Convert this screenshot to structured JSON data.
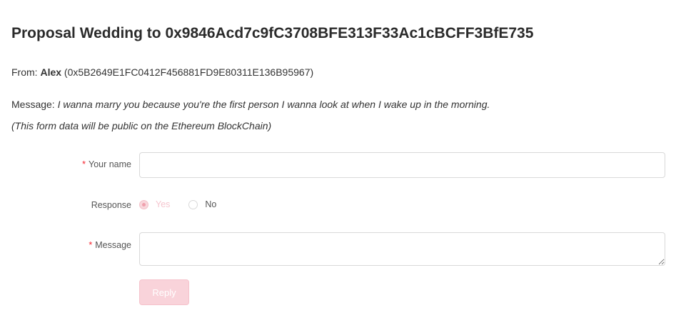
{
  "header": {
    "title": "Proposal Wedding to 0x9846Acd7c9fC3708BFE313F33Ac1cBCFF3BfE735"
  },
  "from": {
    "prefix": "From:",
    "name": "Alex",
    "address": "(0x5B2649E1FC0412F456881FD9E80311E136B95967)"
  },
  "message": {
    "prefix": "Message:",
    "text": "I wanna marry you because you're the first person I wanna look at when I wake up in the morning."
  },
  "notice": "(This form data will be public on the Ethereum BlockChain)",
  "form": {
    "required_mark": "*",
    "name_label": "Your name",
    "name_value": "",
    "response_label": "Response",
    "response_options": [
      "Yes",
      "No"
    ],
    "response_selected": "Yes",
    "message_label": "Message",
    "message_value": "",
    "reply_label": "Reply"
  },
  "colors": {
    "accent_disabled": "#f9d3da",
    "required": "#f5222d",
    "text": "#333333"
  }
}
